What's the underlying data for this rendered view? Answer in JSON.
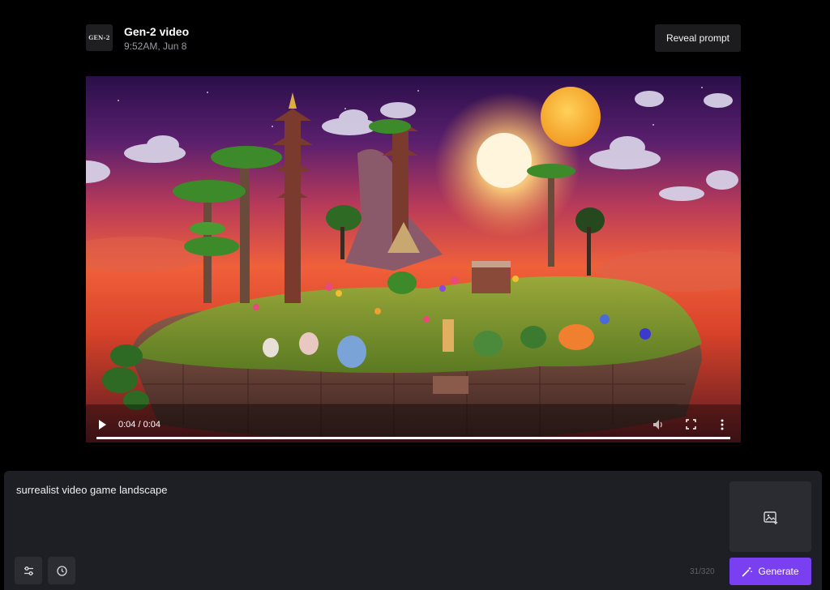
{
  "header": {
    "logo_text": "GEN-2",
    "title": "Gen-2 video",
    "timestamp": "9:52AM, Jun 8",
    "reveal_label": "Reveal prompt"
  },
  "video": {
    "time_display": "0:04 / 0:04",
    "progress_fraction": 1.0,
    "icons": [
      "play-icon",
      "volume-icon",
      "fullscreen-icon",
      "more-vertical-icon"
    ]
  },
  "prompt": {
    "text": "surrealist video game landscape",
    "counter": "31/320",
    "generate_label": "Generate",
    "icons": [
      "sliders-icon",
      "history-clock-icon",
      "add-image-icon",
      "magic-wand-icon"
    ]
  },
  "colors": {
    "background": "#000000",
    "panel": "#1e1f24",
    "accent": "#7b3ff2"
  }
}
